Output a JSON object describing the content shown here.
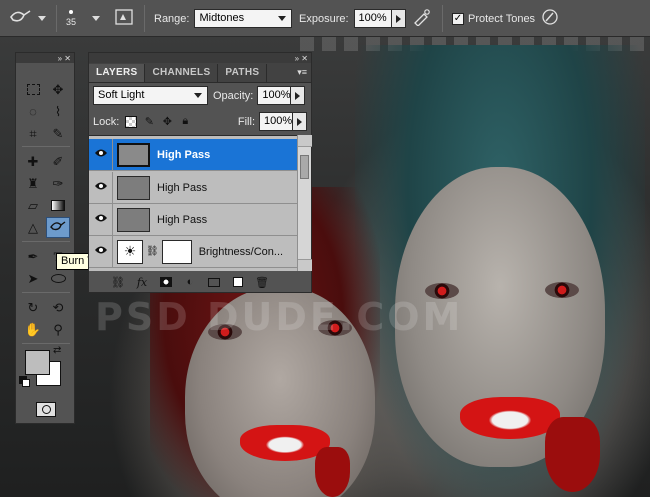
{
  "options_bar": {
    "tool_icon": "burn-tool-icon",
    "brush_size": "35",
    "range_label": "Range:",
    "range_value": "Midtones",
    "exposure_label": "Exposure:",
    "exposure_value": "100%",
    "protect_tones_label": "Protect Tones",
    "protect_tones_checked": true
  },
  "tooltip": {
    "text": "Burn Tool (O)"
  },
  "layers_panel": {
    "tabs": [
      {
        "label": "LAYERS",
        "active": true
      },
      {
        "label": "CHANNELS",
        "active": false
      },
      {
        "label": "PATHS",
        "active": false
      }
    ],
    "blend_mode": "Soft Light",
    "opacity_label": "Opacity:",
    "opacity_value": "100%",
    "lock_label": "Lock:",
    "fill_label": "Fill:",
    "fill_value": "100%",
    "layers": [
      {
        "name": "High Pass",
        "selected": true,
        "visible": true
      },
      {
        "name": "High Pass",
        "selected": false,
        "visible": true
      },
      {
        "name": "High Pass",
        "selected": false,
        "visible": true
      },
      {
        "name": "Brightness/Con...",
        "selected": false,
        "visible": true,
        "adjustment": true
      }
    ]
  },
  "colors": {
    "panel": "#535353",
    "selection": "#1a74d6",
    "tooltip_bg": "#ffffe1",
    "accent_tool": "#6d9bcc"
  },
  "watermark": "PSD DUDE.COM"
}
